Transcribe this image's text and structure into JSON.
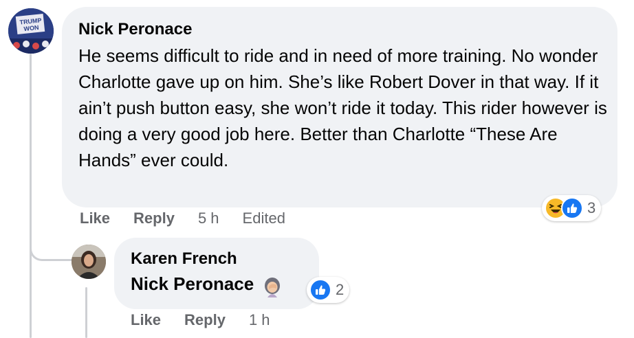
{
  "comment": {
    "author": "Nick Peronace",
    "avatar_text": "TRUMP WON",
    "body": "He seems difficult to ride and in need of more training. No wonder Charlotte gave up on him. She’s like Robert Dover in that way. If it ain’t push button easy, she won’t ride it today. This rider however is doing a very good job here. Better than Charlotte “These Are Hands” ever could.",
    "actions": {
      "like": "Like",
      "reply": "Reply",
      "time": "5 h",
      "edited": "Edited"
    },
    "reactions": {
      "icons": [
        "haha-icon",
        "like-icon"
      ],
      "count": "3"
    }
  },
  "reply": {
    "author": "Karen French",
    "mention": "Nick Peronace",
    "emoji": "woman-facepalming-icon",
    "actions": {
      "like": "Like",
      "reply": "Reply",
      "time": "1 h"
    },
    "reactions": {
      "icons": [
        "like-icon"
      ],
      "count": "2"
    }
  },
  "colors": {
    "bubble": "#f0f2f5",
    "meta": "#65676b",
    "like_blue": "#1877f2",
    "haha_yellow": "#f7b928"
  }
}
